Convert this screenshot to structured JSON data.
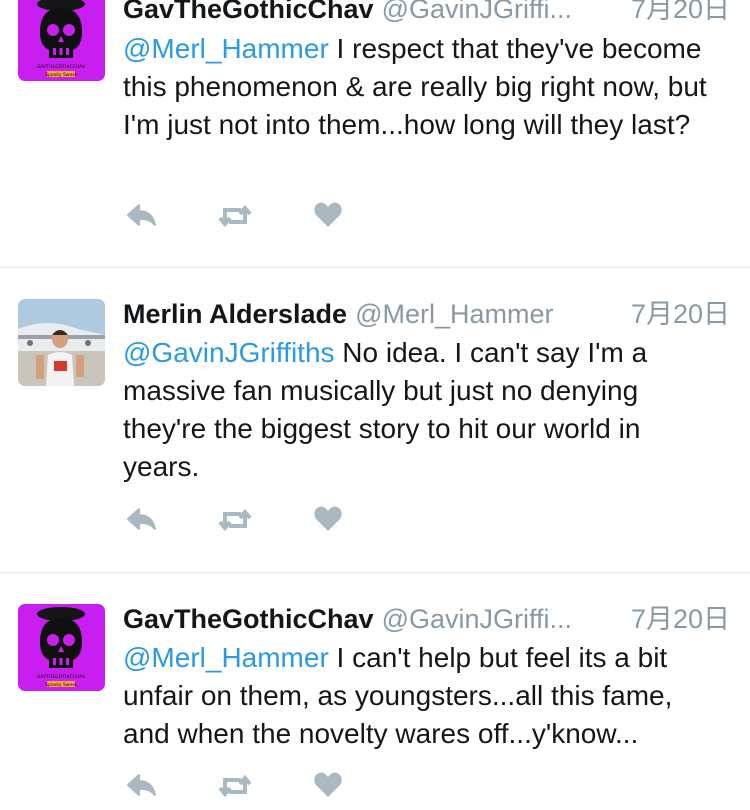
{
  "tweets": [
    {
      "display_name": "GavTheGothicChav",
      "handle": "@GavinJGriffi...",
      "date": "7月20日",
      "mention": "@Merl_Hammer",
      "text": " I respect that they've become this phenomenon & are really big right now, but I'm just not into them...how long will they last?",
      "avatar_text_line1": "GAVTHEGOTHICCHAV",
      "avatar_text_line2": "Spooky Sweet"
    },
    {
      "display_name": "Merlin Alderslade",
      "handle": "@Merl_Hammer",
      "date": "7月20日",
      "mention": "@GavinJGriffiths",
      "text": " No idea. I can't say I'm a massive fan musically but just no denying they're the biggest story to hit our world in years."
    },
    {
      "display_name": "GavTheGothicChav",
      "handle": "@GavinJGriffi...",
      "date": "7月20日",
      "mention": "@Merl_Hammer",
      "text": " I can't help but feel its a bit unfair on them, as youngsters...all this fame, and when the novelty wares off...y'know...",
      "avatar_text_line1": "GAVTHEGOTHICCHAV",
      "avatar_text_line2": "Spooky Sweet"
    }
  ],
  "actions": {
    "reply_icon": "reply-icon",
    "retweet_icon": "retweet-icon",
    "like_icon": "heart-icon"
  },
  "colors": {
    "mention": "#2b9ae6",
    "muted": "#8899a6",
    "icon": "#aab8c2",
    "divider": "#e1e8ed",
    "avatar_bg": "#c81ef0"
  }
}
